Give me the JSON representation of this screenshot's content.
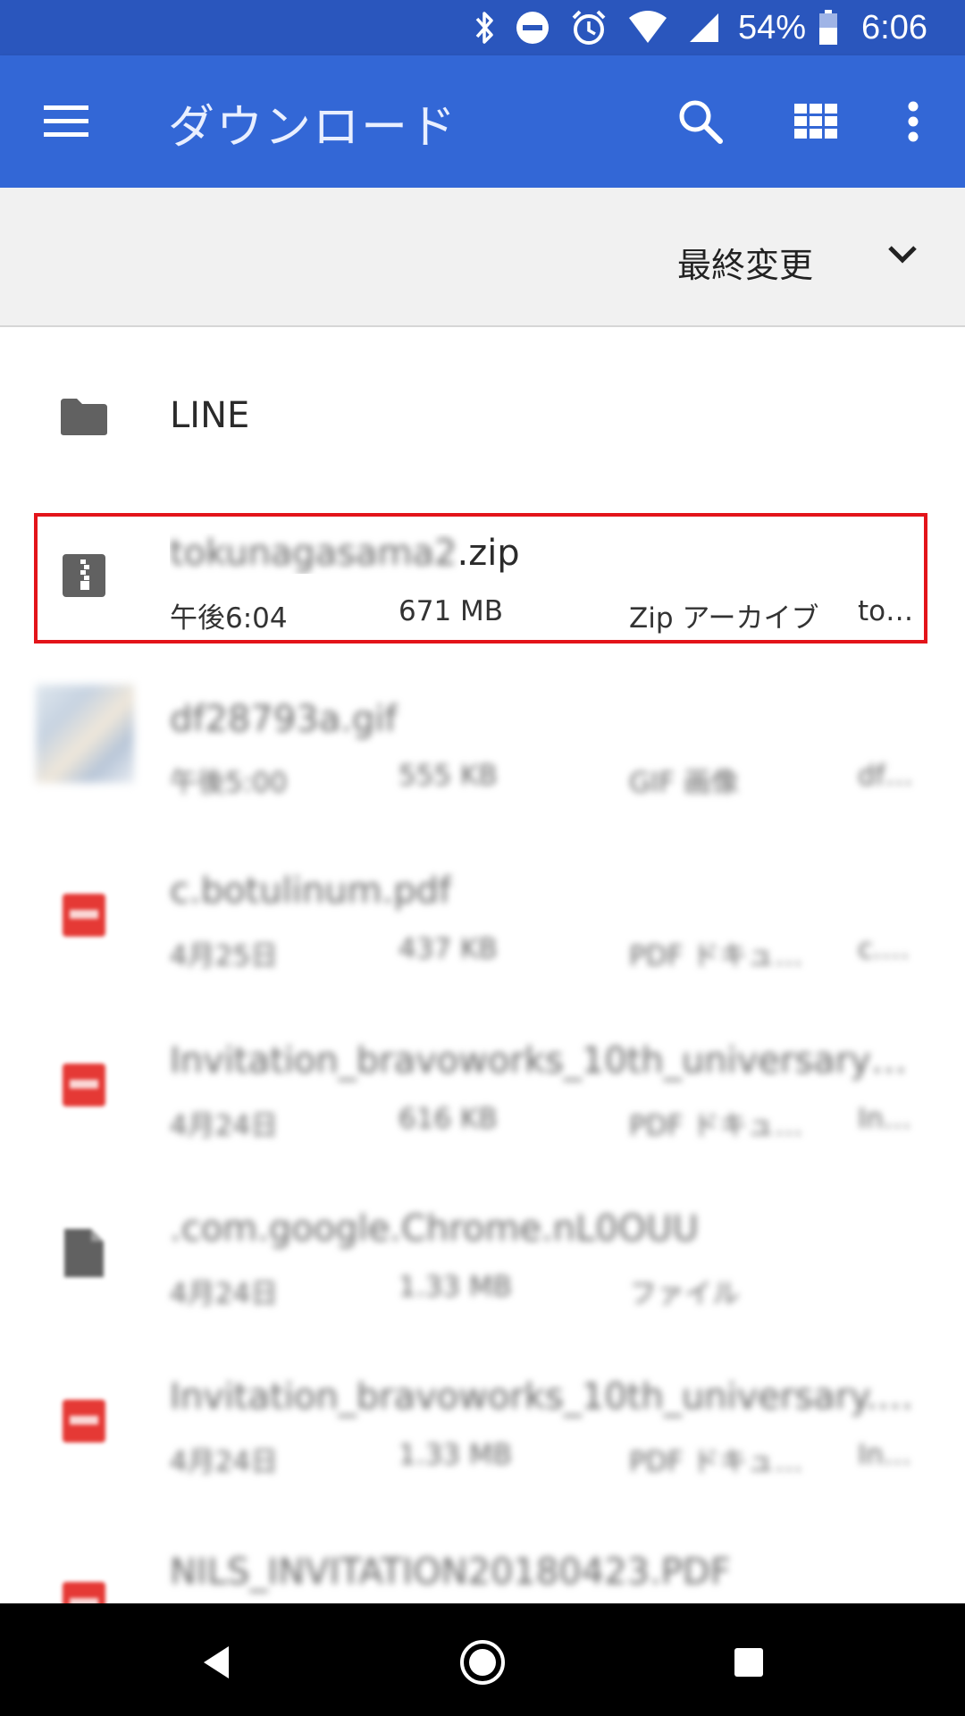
{
  "status_bar": {
    "battery_percent": "54%",
    "time": "6:06",
    "icons": [
      "bluetooth-icon",
      "do-not-disturb-icon",
      "alarm-icon",
      "wifi-icon",
      "cell-signal-icon",
      "battery-icon"
    ]
  },
  "app_bar": {
    "title": "ダウンロード",
    "icons": [
      "menu-icon",
      "search-icon",
      "grid-view-icon",
      "more-vert-icon"
    ]
  },
  "sort_bar": {
    "label": "最終変更",
    "icon": "chevron-down-icon"
  },
  "files": [
    {
      "name": "LINE",
      "kind": "folder",
      "icon": "folder-icon"
    },
    {
      "name": "tokunagasama2.zip",
      "date": "午後6:04",
      "size": "671 MB",
      "type": "Zip アーカイブ",
      "extra": "tok…",
      "icon": "zip-icon",
      "highlighted": true
    },
    {
      "name": "df28793a.gif",
      "date": "午後5:00",
      "size": "555 KB",
      "type": "GIF 画像",
      "extra": "df2…",
      "icon": "image-thumbnail",
      "blurred": true
    },
    {
      "name": "c.botulinum.pdf",
      "date": "4月25日",
      "size": "437 KB",
      "type": "PDF ドキュメ…",
      "extra": "c.b…",
      "icon": "pdf-icon",
      "blurred": true
    },
    {
      "name": "Invitation_bravoworks_10th_universary_rev1…",
      "date": "4月24日",
      "size": "616 KB",
      "type": "PDF ドキュメ…",
      "extra": "Inv…",
      "icon": "pdf-icon",
      "blurred": true
    },
    {
      "name": ".com.google.Chrome.nL0OUU",
      "date": "4月24日",
      "size": "1.33 MB",
      "type": "ファイル",
      "extra": "",
      "icon": "file-icon",
      "blurred": true
    },
    {
      "name": "Invitation_bravoworks_10th_universary.pdf",
      "date": "4月24日",
      "size": "1.33 MB",
      "type": "PDF ドキュメ…",
      "extra": "Inv…",
      "icon": "pdf-icon",
      "blurred": true
    },
    {
      "name": "NILS_INVITATION20180423.PDF",
      "date": "",
      "size": "",
      "type": "",
      "extra": "",
      "icon": "pdf-icon",
      "blurred": true
    }
  ],
  "nav_bar": {
    "icons": [
      "back-icon",
      "home-icon",
      "recents-icon"
    ]
  },
  "colors": {
    "status_bar": "#2a56bd",
    "app_bar": "#3367d6",
    "highlight": "#e3141a",
    "pdf_red": "#e53935"
  }
}
